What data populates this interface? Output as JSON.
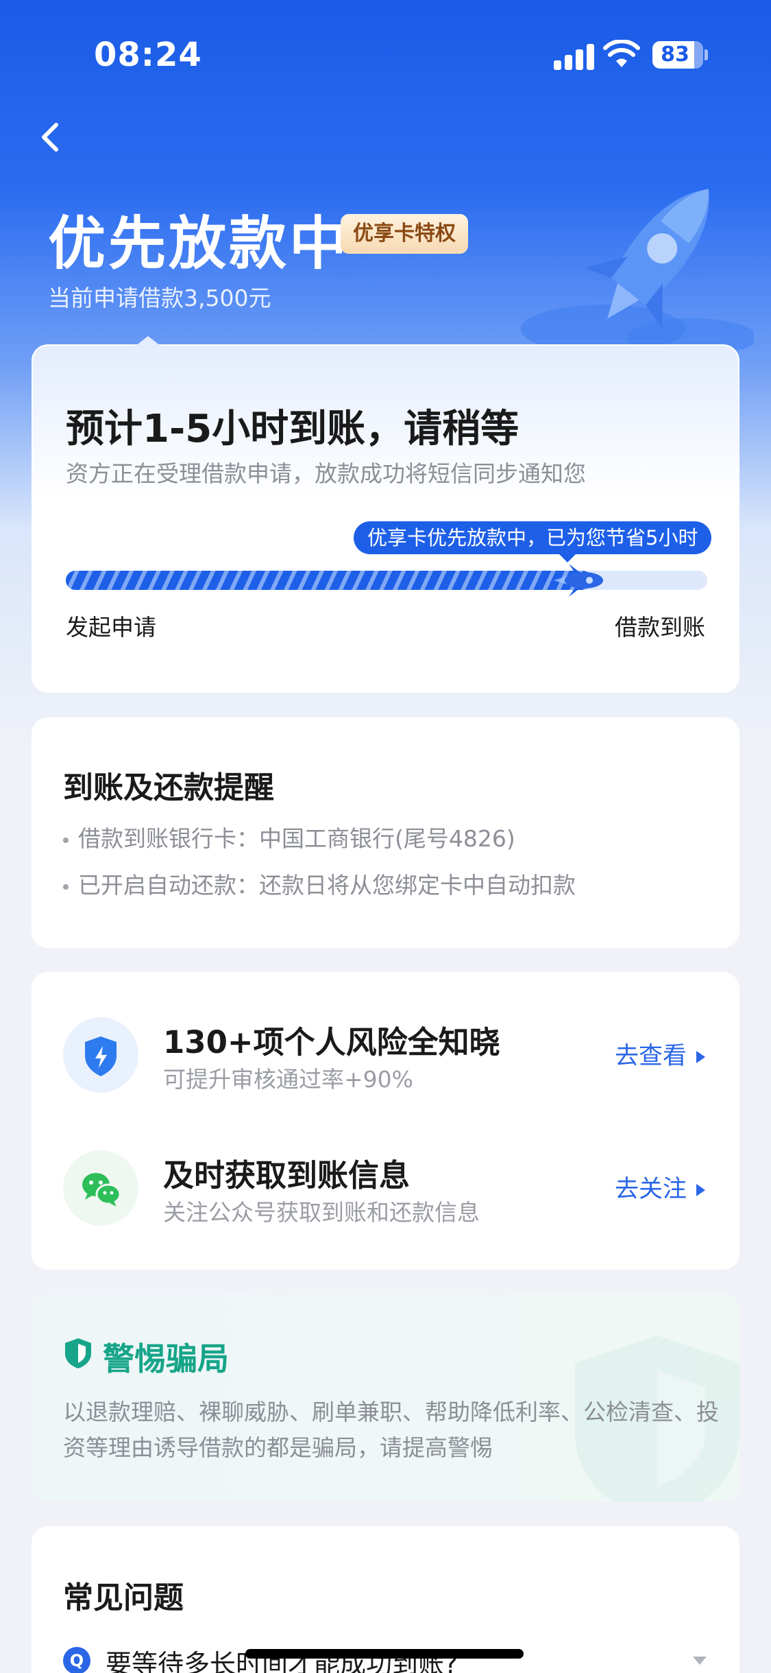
{
  "status_bar": {
    "time": "08:24",
    "battery": "83",
    "battery_level": 0.83
  },
  "header": {
    "title": "优先放款中",
    "badge": "优享卡特权",
    "subtitle": "当前申请借款3,500元"
  },
  "progress_card": {
    "title": "预计1-5小时到账，请稍等",
    "description": "资方正在受理借款申请，放款成功将短信同步通知您",
    "bubble": "优享卡优先放款中，已为您节省5小时",
    "progress": 0.82,
    "start_label": "发起申请",
    "end_label": "借款到账"
  },
  "reminder_card": {
    "title": "到账及还款提醒",
    "lines": [
      "借款到账银行卡：中国工商银行(尾号4826)",
      "已开启自动还款：还款日将从您绑定卡中自动扣款"
    ]
  },
  "services": [
    {
      "title": "130+项个人风险全知晓",
      "subtitle": "可提升审核通过率+90%",
      "link": "去查看",
      "icon": "shield-bolt-icon"
    },
    {
      "title": "及时获取到账信息",
      "subtitle": "关注公众号获取到账和还款信息",
      "link": "去关注",
      "icon": "wechat-icon"
    }
  ],
  "fraud_card": {
    "title": "警惕骗局",
    "text": "以退款理赔、裸聊威胁、刷单兼职、帮助降低利率、公检清查、投资等理由诱导借款的都是骗局，请提高警惕"
  },
  "faq_card": {
    "title": "常见问题",
    "q_icon": "Q",
    "question": "要等待多长时间才能成功到账?"
  },
  "colors": {
    "primary": "#1e5fe8",
    "accent_green": "#17a589",
    "badge_text": "#8a4a14"
  }
}
